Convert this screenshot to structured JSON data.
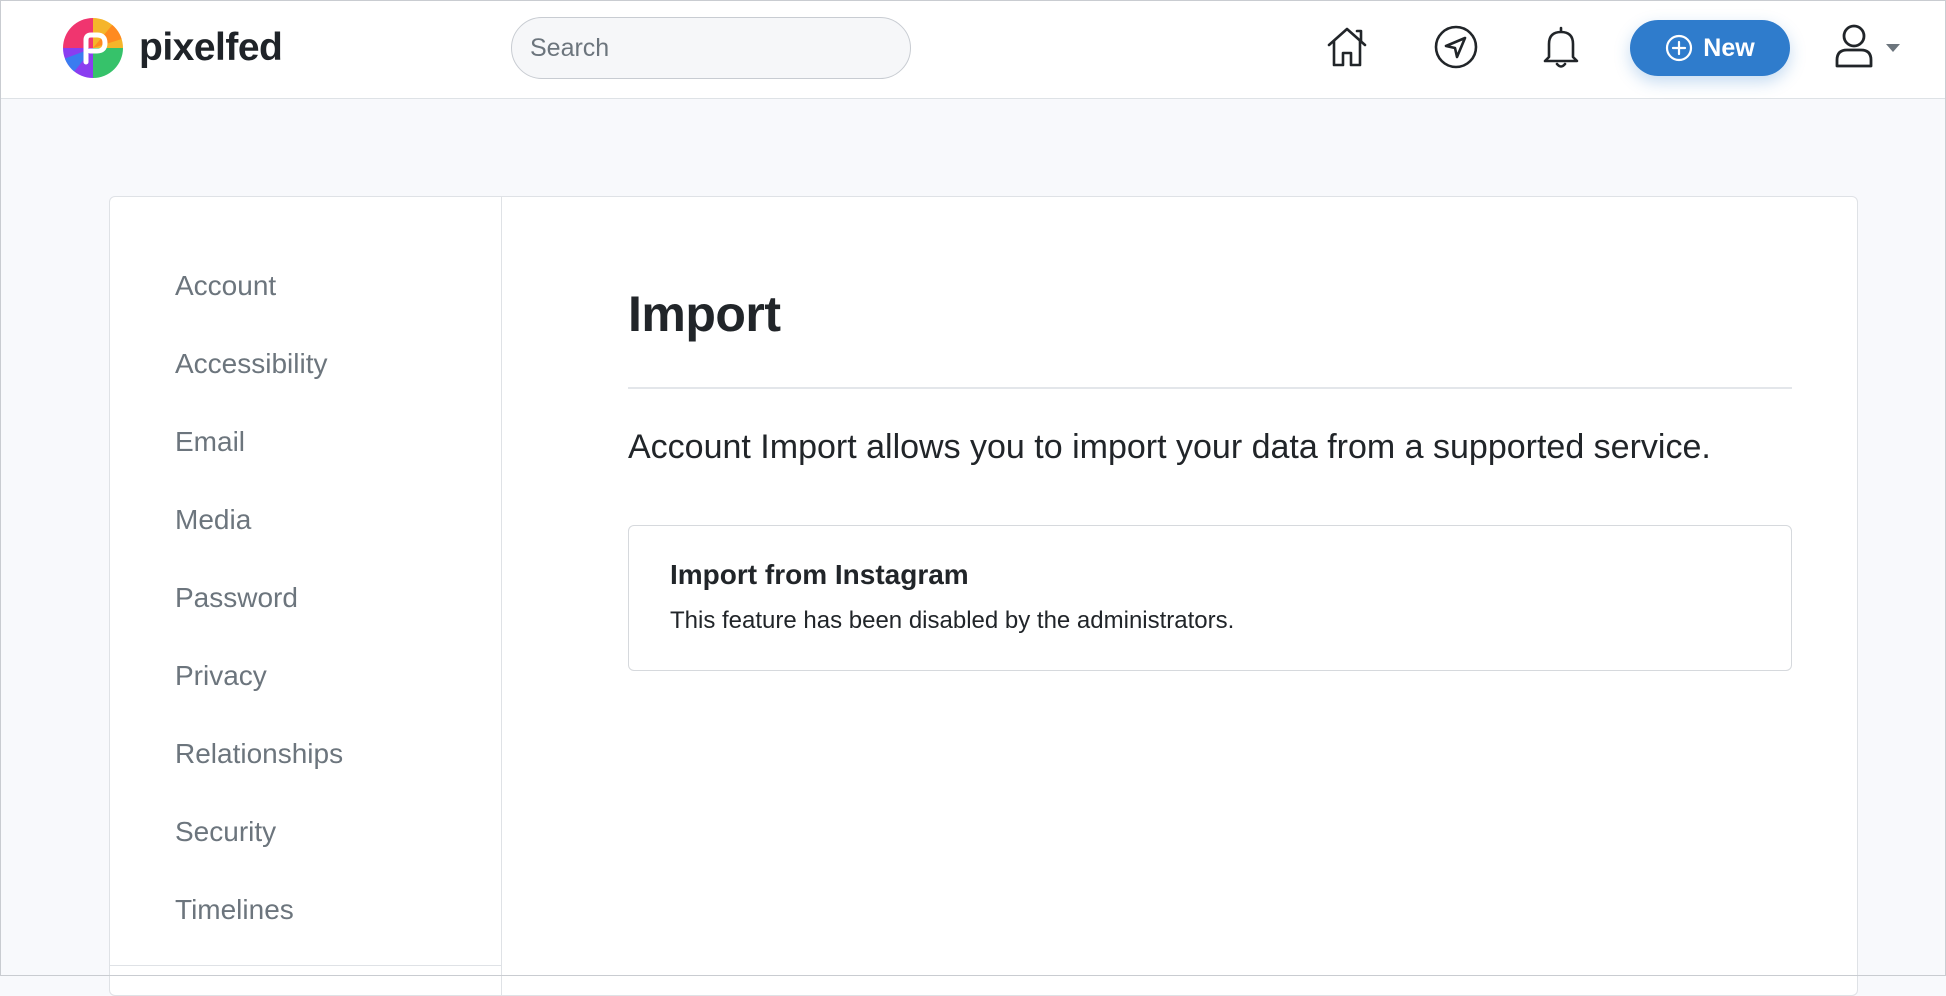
{
  "app": {
    "name": "pixelfed"
  },
  "search": {
    "placeholder": "Search",
    "icon": "search"
  },
  "nav_icons": [
    "home-icon",
    "explore-compass-icon",
    "bell-icon"
  ],
  "new_button": {
    "label": "New",
    "icon": "plus-circle-icon",
    "color": "#2f7ccc"
  },
  "user_menu": {
    "icon": "user-icon",
    "caret": "caret-down-icon"
  },
  "sidebar": {
    "items": [
      {
        "label": "Account"
      },
      {
        "label": "Accessibility"
      },
      {
        "label": "Email"
      },
      {
        "label": "Media"
      },
      {
        "label": "Password"
      },
      {
        "label": "Privacy"
      },
      {
        "label": "Relationships"
      },
      {
        "label": "Security"
      },
      {
        "label": "Timelines"
      }
    ]
  },
  "main": {
    "title": "Import",
    "lead": "Account Import allows you to import your data from a supported service.",
    "import_card": {
      "title": "Import from Instagram",
      "message": "This feature has been disabled by the administrators."
    }
  }
}
